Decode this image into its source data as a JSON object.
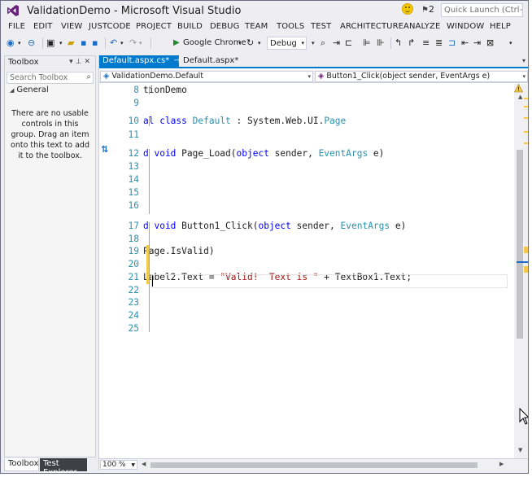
{
  "window": {
    "title": "ValidationDemo - Microsoft Visual Studio",
    "notifications_count": "2",
    "quick_launch_placeholder": "Quick Launch (Ctrl+Q)"
  },
  "menu": [
    "FILE",
    "EDIT",
    "VIEW",
    "JUSTCODE",
    "PROJECT",
    "BUILD",
    "DEBUG",
    "TEAM",
    "TOOLS",
    "TEST",
    "ARCHITECTURE",
    "ANALYZE",
    "WINDOW",
    "HELP"
  ],
  "toolbar": {
    "browser_label": "Google Chrome",
    "config_value": "Debug"
  },
  "toolbox": {
    "title": "Toolbox",
    "search_placeholder": "Search Toolbox",
    "group_label": "General",
    "empty_message": "There are no usable controls in this group. Drag an item onto this text to add it to the toolbox."
  },
  "bottom_tabs": {
    "toolbox": "Toolbox",
    "test_explorer": "Test Explorer"
  },
  "editor": {
    "tabs": [
      {
        "label": "Default.aspx.cs*",
        "active": true
      },
      {
        "label": "Default.aspx*",
        "active": false
      }
    ],
    "nav_left": "ValidationDemo.Default",
    "nav_right": "Button1_Click(object sender, EventArgs e)",
    "zoom": "100 %",
    "lines": [
      {
        "n": "8",
        "text": "tionDemo"
      },
      {
        "n": "9",
        "text": ""
      },
      {
        "n": "10",
        "text": "al class Default : System.Web.UI.Page"
      },
      {
        "n": "11",
        "text": ""
      },
      {
        "n": "12",
        "text": "d void Page_Load(object sender, EventArgs e)"
      },
      {
        "n": "13",
        "text": ""
      },
      {
        "n": "14",
        "text": ""
      },
      {
        "n": "15",
        "text": ""
      },
      {
        "n": "16",
        "text": ""
      },
      {
        "n": "17",
        "text": "d void Button1_Click(object sender, EventArgs e)"
      },
      {
        "n": "18",
        "text": ""
      },
      {
        "n": "19",
        "text": "Page.IsValid)"
      },
      {
        "n": "20",
        "text": ""
      },
      {
        "n": "21",
        "text": "Label2.Text = \"Valid!  Text is \" + TextBox1.Text;"
      },
      {
        "n": "22",
        "text": ""
      },
      {
        "n": "23",
        "text": ""
      },
      {
        "n": "24",
        "text": ""
      },
      {
        "n": "25",
        "text": ""
      }
    ]
  },
  "colors": {
    "accent": "#007acc",
    "keyword": "#0000ff",
    "type": "#2b91af",
    "string": "#a31515",
    "change_marker": "#f2c94c"
  }
}
